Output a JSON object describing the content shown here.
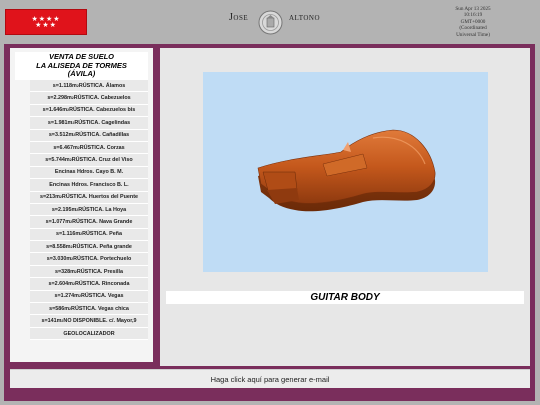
{
  "header": {
    "brand_left": "Jose",
    "brand_right": "altono",
    "flag_stars": "★★★★★★★",
    "date_lines": [
      "Sun Apr 13 2025",
      "10:16:19",
      "GMT+0000",
      "(Coordinated",
      "Universal Time)"
    ]
  },
  "sidebar": {
    "title_lines": [
      "VENTA DE SUELO",
      "LA ALISEDA DE TORMES",
      "(ÁVILA)"
    ],
    "items": [
      {
        "pre": "s=1.118m",
        "sup": "2",
        "post": " RÚSTICA. Álamos"
      },
      {
        "pre": "s=2.298m",
        "sup": "2",
        "post": " RÚSTICA. Cabezuelos"
      },
      {
        "pre": "s=1.646m",
        "sup": "2",
        "post": " RÚSTICA. Cabezuelos bis"
      },
      {
        "pre": "s=1.981m",
        "sup": "2",
        "post": " RÚSTICA. Cagelindas"
      },
      {
        "pre": "s=3.512m",
        "sup": "2",
        "post": " RÚSTICA. Cañadillas"
      },
      {
        "pre": "s=6.467m",
        "sup": "2",
        "post": " RÚSTICA. Corzas"
      },
      {
        "pre": "s=5.744m",
        "sup": "2",
        "post": " RÚSTICA. Cruz del Viso"
      },
      {
        "pre": "Encinas Hdros. Cayo B. M.",
        "sup": "",
        "post": ""
      },
      {
        "pre": "Encinas Hdros. Francisco B. L.",
        "sup": "",
        "post": ""
      },
      {
        "pre": "s=213m",
        "sup": "2",
        "post": " RÚSTICA. Huertos del Puente"
      },
      {
        "pre": "s=2.195m",
        "sup": "2",
        "post": " RÚSTICA. La Hoya"
      },
      {
        "pre": "s=1.077m",
        "sup": "2",
        "post": " RÚSTICA. Nava Grande"
      },
      {
        "pre": "s=1.116m",
        "sup": "2",
        "post": " RÚSTICA. Peña"
      },
      {
        "pre": "s=8.558m",
        "sup": "2",
        "post": " RÚSTICA. Peña grande"
      },
      {
        "pre": "s=3.030m",
        "sup": "2",
        "post": " RÚSTICA. Portechuelo"
      },
      {
        "pre": "s=328m",
        "sup": "2",
        "post": " RÚSTICA. Presilla"
      },
      {
        "pre": "s=2.604m",
        "sup": "2",
        "post": " RÚSTICA. Rinconada"
      },
      {
        "pre": "s=1.274m",
        "sup": "2",
        "post": " RÚSTICA. Vegas"
      },
      {
        "pre": "s=586m",
        "sup": "2",
        "post": " RÚSTICA. Vegas chica"
      },
      {
        "pre": "s=141m",
        "sup": "2",
        "post": " NO DISPONIBLE. c/. Mayor,9"
      },
      {
        "pre": "GEOLOCALIZADOR",
        "sup": "",
        "post": ""
      }
    ]
  },
  "main": {
    "caption": "GUITAR BODY"
  },
  "footer": {
    "link": "Haga click aquí para generar e-mail"
  },
  "colors": {
    "frame": "#7a2e5c",
    "flag": "#e0131b",
    "canvas": "#bfdcf5",
    "wood": "#c4581c"
  }
}
